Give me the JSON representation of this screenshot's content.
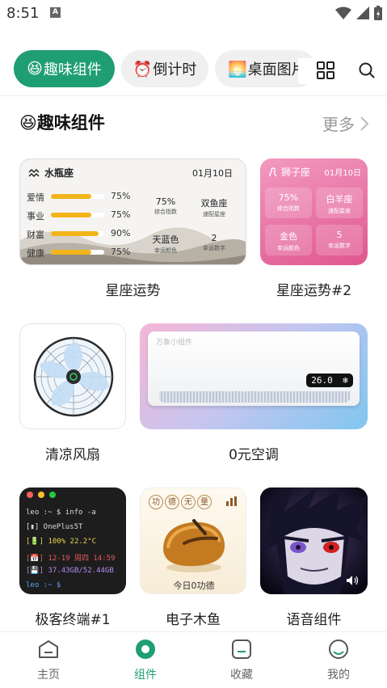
{
  "status_bar": {
    "time": "8:51",
    "notif_letter": "A"
  },
  "chips": [
    {
      "emoji": "😆",
      "label": "趣味组件",
      "active": true
    },
    {
      "emoji": "⏰",
      "label": "倒计时",
      "active": false
    },
    {
      "emoji": "🌅",
      "label": "桌面图片",
      "active": false
    }
  ],
  "section": {
    "emoji": "😆",
    "title": "趣味组件",
    "more": "更多"
  },
  "astro_card": {
    "sign": "水瓶座",
    "date": "01月10日",
    "rows": [
      {
        "name": "爱情",
        "pct": "75%",
        "fill": 0.75
      },
      {
        "name": "事业",
        "pct": "75%",
        "fill": 0.75
      },
      {
        "name": "财富",
        "pct": "90%",
        "fill": 0.9
      },
      {
        "name": "健康",
        "pct": "75%",
        "fill": 0.75
      }
    ],
    "stats": [
      {
        "value": "75%",
        "sub": "综合指数"
      },
      {
        "value": "双鱼座",
        "sub": "速配星座"
      },
      {
        "value": "天蓝色",
        "sub": "幸运颜色"
      },
      {
        "value": "2",
        "sub": "幸运数字"
      }
    ]
  },
  "pink_card": {
    "sign": "狮子座",
    "date": "01月10日",
    "stats": [
      {
        "value": "75%",
        "sub": "综合指数"
      },
      {
        "value": "白羊座",
        "sub": "速配星座"
      },
      {
        "value": "金色",
        "sub": "幸运颜色"
      },
      {
        "value": "5",
        "sub": "幸运数字"
      }
    ]
  },
  "ac_card": {
    "brand": "万象小组件",
    "temp": "26.0"
  },
  "terminal": {
    "lines": [
      {
        "text": "leo :~ $ info -a",
        "color": "#dddddd"
      },
      {
        "text": "[▮] OnePlus5T",
        "color": "#dddddd"
      },
      {
        "text": "[🔋] 100% 22.2°C",
        "color": "#e6d34a"
      },
      {
        "text": "[📅] 12-19 周四 14:59",
        "color": "#e85a5a"
      },
      {
        "text": "[💾] 37.43GB/52.44GB",
        "color": "#b48cf0"
      },
      {
        "text": "leo :~ $",
        "color": "#5aa3f0"
      }
    ]
  },
  "woodfish": {
    "chars": [
      "功",
      "德",
      "无",
      "量"
    ],
    "merit": "今日0功德"
  },
  "widget_labels": [
    "星座运势",
    "星座运势#2",
    "清凉风扇",
    "0元空调",
    "极客终端#1",
    "电子木鱼",
    "语音组件"
  ],
  "nav": [
    {
      "label": "主页",
      "active": false
    },
    {
      "label": "组件",
      "active": true
    },
    {
      "label": "收藏",
      "active": false
    },
    {
      "label": "我的",
      "active": false
    }
  ],
  "colors": {
    "accent": "#1f9e74",
    "inactive_text": "#666666",
    "bar_fill": "#f3b41b"
  }
}
